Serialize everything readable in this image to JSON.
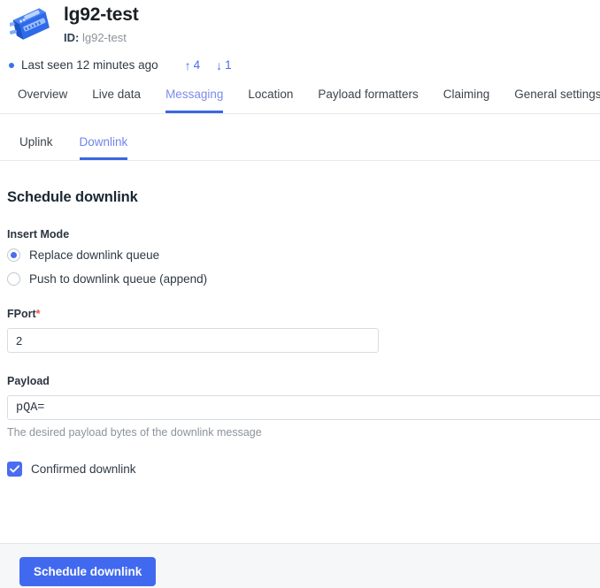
{
  "header": {
    "icon": "gateway-device-icon",
    "device_name": "lg92-test",
    "id_label": "ID:",
    "id_value": "lg92-test"
  },
  "status": {
    "last_seen": "Last seen 12 minutes ago",
    "uplink_arrow": "↑",
    "uplink_count": "4",
    "downlink_arrow": "↓",
    "downlink_count": "1"
  },
  "tabs": [
    {
      "label": "Overview",
      "active": false
    },
    {
      "label": "Live data",
      "active": false
    },
    {
      "label": "Messaging",
      "active": true
    },
    {
      "label": "Location",
      "active": false
    },
    {
      "label": "Payload formatters",
      "active": false
    },
    {
      "label": "Claiming",
      "active": false
    },
    {
      "label": "General settings",
      "active": true
    }
  ],
  "subtabs": [
    {
      "label": "Uplink",
      "active": false
    },
    {
      "label": "Downlink",
      "active": true
    }
  ],
  "form": {
    "title": "Schedule downlink",
    "insert_mode_label": "Insert Mode",
    "radio_replace": "Replace downlink queue",
    "radio_push": "Push to downlink queue (append)",
    "fport_label": "FPort",
    "required_marker": "*",
    "fport_value": "2",
    "fport_placeholder": "",
    "payload_label": "Payload",
    "payload_value": "pQA=",
    "payload_placeholder": "",
    "payload_help": "The desired payload bytes of the downlink message",
    "confirmed_label": "Confirmed downlink",
    "submit_label": "Schedule downlink"
  },
  "colors": {
    "accent": "#4169f0",
    "tab_active": "#3a67e0",
    "required": "#e8594b",
    "muted": "#8b939c"
  }
}
